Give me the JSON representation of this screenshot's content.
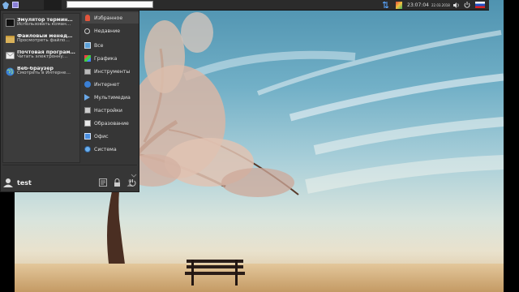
{
  "panel": {
    "time": "23:07:04",
    "date": "22.03.2018",
    "search_value": ""
  },
  "favorites": [
    {
      "title": "Эмулятор термин…",
      "subtitle": "Использовать коман…",
      "icon": "terminal-icon"
    },
    {
      "title": "Файловый менед…",
      "subtitle": "Просмотреть файло…",
      "icon": "folder-icon"
    },
    {
      "title": "Почтовая програм…",
      "subtitle": "Читать электронну…",
      "icon": "mail-icon"
    },
    {
      "title": "Веб-браузер",
      "subtitle": "Смотреть в Интерне…",
      "icon": "globe-icon"
    }
  ],
  "categories": [
    {
      "label": "Избранное",
      "icon": "favorites-icon",
      "selected": true
    },
    {
      "label": "Недавние",
      "icon": "recent-icon",
      "selected": false
    },
    {
      "label": "Все",
      "icon": "all-icon",
      "selected": false
    },
    {
      "label": "Графика",
      "icon": "graphics-icon",
      "selected": false
    },
    {
      "label": "Инструменты",
      "icon": "tools-icon",
      "selected": false
    },
    {
      "label": "Интернет",
      "icon": "internet-icon",
      "selected": false
    },
    {
      "label": "Мультимедиа",
      "icon": "multimedia-icon",
      "selected": false
    },
    {
      "label": "Настройки",
      "icon": "settings-icon",
      "selected": false
    },
    {
      "label": "Образование",
      "icon": "education-icon",
      "selected": false
    },
    {
      "label": "Офис",
      "icon": "office-icon",
      "selected": false
    },
    {
      "label": "Система",
      "icon": "system-icon",
      "selected": false
    }
  ],
  "user": {
    "name": "test"
  },
  "colors": {
    "accent": "#e2553c",
    "menu_bg": "#363636",
    "panel_bg": "#2b2b2b"
  }
}
